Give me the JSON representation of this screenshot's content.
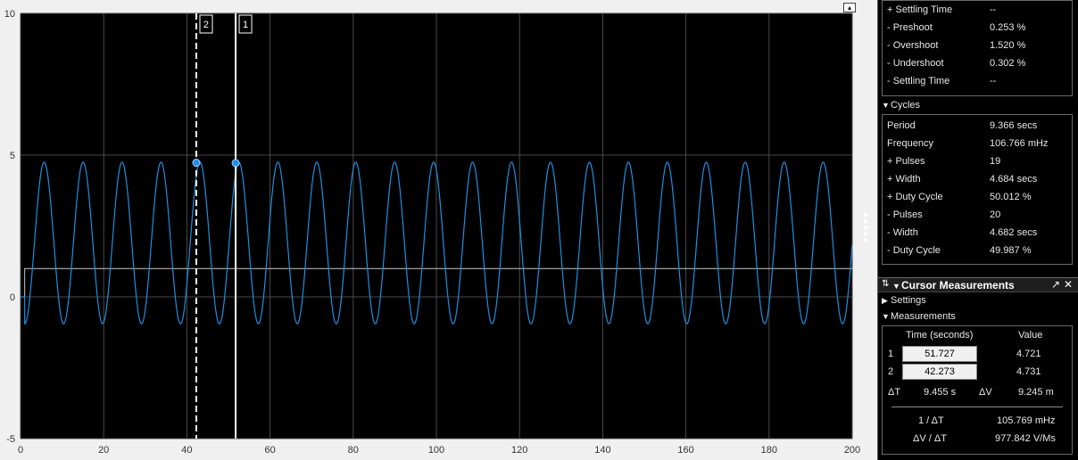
{
  "plot": {
    "x_ticks": [
      "0",
      "20",
      "40",
      "60",
      "80",
      "100",
      "120",
      "140",
      "160",
      "180",
      "200"
    ],
    "y_ticks": [
      "10",
      "5",
      "0",
      "-5"
    ],
    "cursor_labels": [
      "2",
      "1"
    ],
    "colors": {
      "background": "#000000",
      "grid": "#4a4a4a",
      "signal": "#1e8fe0",
      "cursor": "#ffffff",
      "reference": "#c8c8c8"
    }
  },
  "chart_data": {
    "type": "line",
    "xlim": [
      0,
      200
    ],
    "ylim": [
      -5,
      10
    ],
    "grid": true,
    "series": [
      {
        "role": "signal",
        "period": 9.366,
        "mean": 1.9,
        "amplitude": 2.85,
        "sample_start": 1.0,
        "x_end": 200
      },
      {
        "role": "reference",
        "steps": [
          [
            0,
            0
          ],
          [
            1.0,
            1.0
          ],
          [
            200,
            1.0
          ]
        ]
      }
    ],
    "cursors": [
      {
        "label": "1",
        "x": 51.727,
        "y": 4.721,
        "style": "solid"
      },
      {
        "label": "2",
        "x": 42.273,
        "y": 4.731,
        "style": "dashed"
      }
    ]
  },
  "panel": {
    "transitions_rows": [
      {
        "label": "+ Settling Time",
        "value": "--"
      },
      {
        "label": "- Preshoot",
        "value": "0.253 %"
      },
      {
        "label": "- Overshoot",
        "value": "1.520 %"
      },
      {
        "label": "- Undershoot",
        "value": "0.302 %"
      },
      {
        "label": "- Settling Time",
        "value": "--"
      }
    ],
    "cycles": {
      "title": "Cycles",
      "rows": [
        {
          "label": "Period",
          "value": "9.366 secs"
        },
        {
          "label": "Frequency",
          "value": "106.766 mHz"
        },
        {
          "label": "+ Pulses",
          "value": "19"
        },
        {
          "label": "+ Width",
          "value": "4.684 secs"
        },
        {
          "label": "+ Duty Cycle",
          "value": "50.012 %"
        },
        {
          "label": "- Pulses",
          "value": "20"
        },
        {
          "label": "- Width",
          "value": "4.682 secs"
        },
        {
          "label": "- Duty Cycle",
          "value": "49.987 %"
        }
      ]
    },
    "cursor_measurements": {
      "title": "Cursor Measurements",
      "settings_label": "Settings",
      "measurements_label": "Measurements",
      "col_time": "Time (seconds)",
      "col_value": "Value",
      "cursors": [
        {
          "index": "1",
          "time": "51.727",
          "value": "4.721"
        },
        {
          "index": "2",
          "time": "42.273",
          "value": "4.731"
        }
      ],
      "delta_t_label": "ΔT",
      "delta_t_value": "9.455 s",
      "delta_v_label": "ΔV",
      "delta_v_value": "9.245 m",
      "inv_dt_label": "1 / ΔT",
      "inv_dt_value": "105.769 mHz",
      "dv_dt_label": "ΔV / ΔT",
      "dv_dt_value": "977.842 V/Ms"
    }
  }
}
